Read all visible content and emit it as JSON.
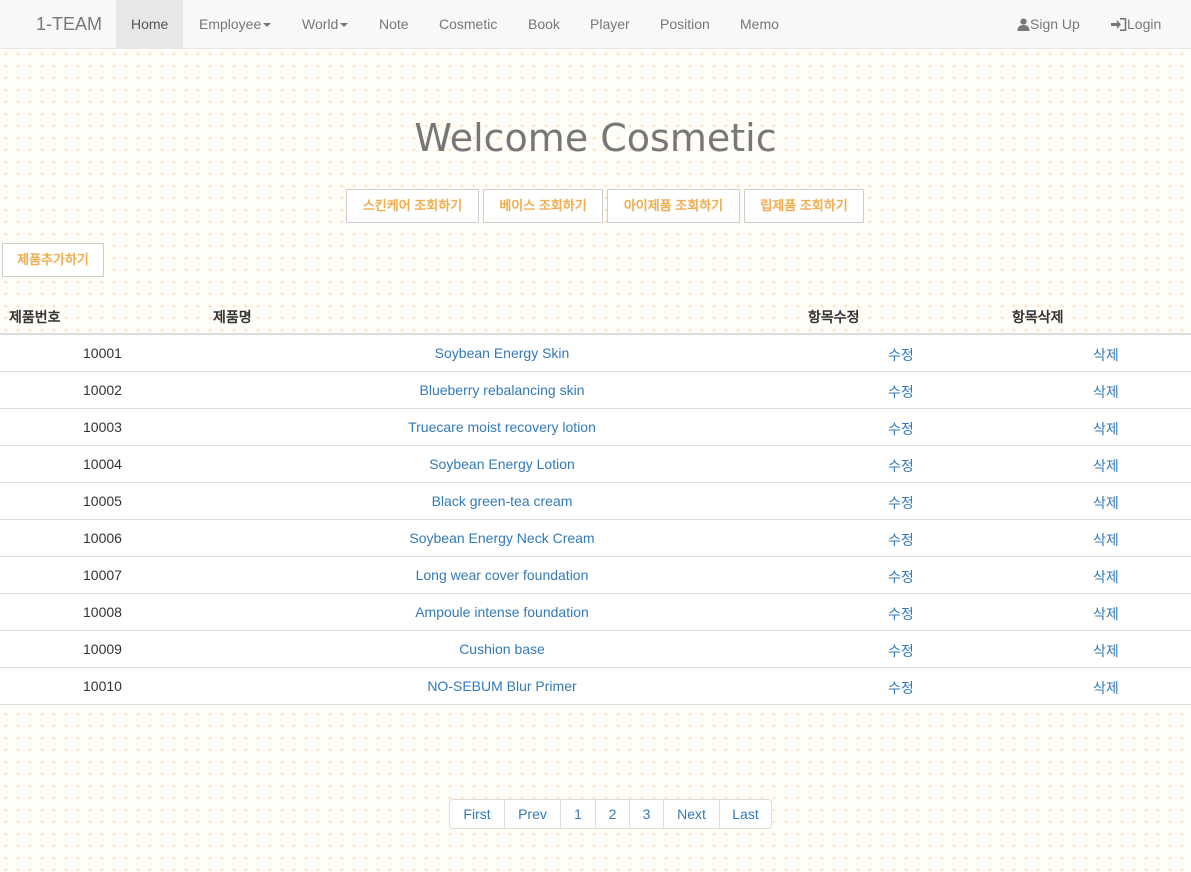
{
  "nav": {
    "brand": "1-TEAM",
    "home": "Home",
    "employee": "Employee",
    "world": "World",
    "note": "Note",
    "cosmetic": "Cosmetic",
    "book": "Book",
    "player": "Player",
    "position": "Position",
    "memo": "Memo",
    "signup": "Sign Up",
    "login": "Login"
  },
  "hero": {
    "title": "Welcome Cosmetic"
  },
  "categories": [
    "스킨케어 조회하기",
    "베이스 조회하기",
    "아이제품 조회하기",
    "립제품 조회하기"
  ],
  "add_button": "제품추가하기",
  "table": {
    "headers": [
      "제품번호",
      "제품명",
      "항목수정",
      "항목삭제"
    ],
    "rows": [
      {
        "id": "10001",
        "name": "Soybean Energy Skin",
        "edit": "수정",
        "delete": "삭제"
      },
      {
        "id": "10002",
        "name": "Blueberry rebalancing skin",
        "edit": "수정",
        "delete": "삭제"
      },
      {
        "id": "10003",
        "name": "Truecare moist recovery lotion",
        "edit": "수정",
        "delete": "삭제"
      },
      {
        "id": "10004",
        "name": "Soybean Energy Lotion",
        "edit": "수정",
        "delete": "삭제"
      },
      {
        "id": "10005",
        "name": "Black green-tea cream",
        "edit": "수정",
        "delete": "삭제"
      },
      {
        "id": "10006",
        "name": "Soybean Energy Neck Cream",
        "edit": "수정",
        "delete": "삭제"
      },
      {
        "id": "10007",
        "name": "Long wear cover foundation",
        "edit": "수정",
        "delete": "삭제"
      },
      {
        "id": "10008",
        "name": "Ampoule intense foundation",
        "edit": "수정",
        "delete": "삭제"
      },
      {
        "id": "10009",
        "name": "Cushion base",
        "edit": "수정",
        "delete": "삭제"
      },
      {
        "id": "10010",
        "name": "NO-SEBUM Blur Primer",
        "edit": "수정",
        "delete": "삭제"
      }
    ]
  },
  "pagination": [
    "First",
    "Prev",
    "1",
    "2",
    "3",
    "Next",
    "Last"
  ]
}
